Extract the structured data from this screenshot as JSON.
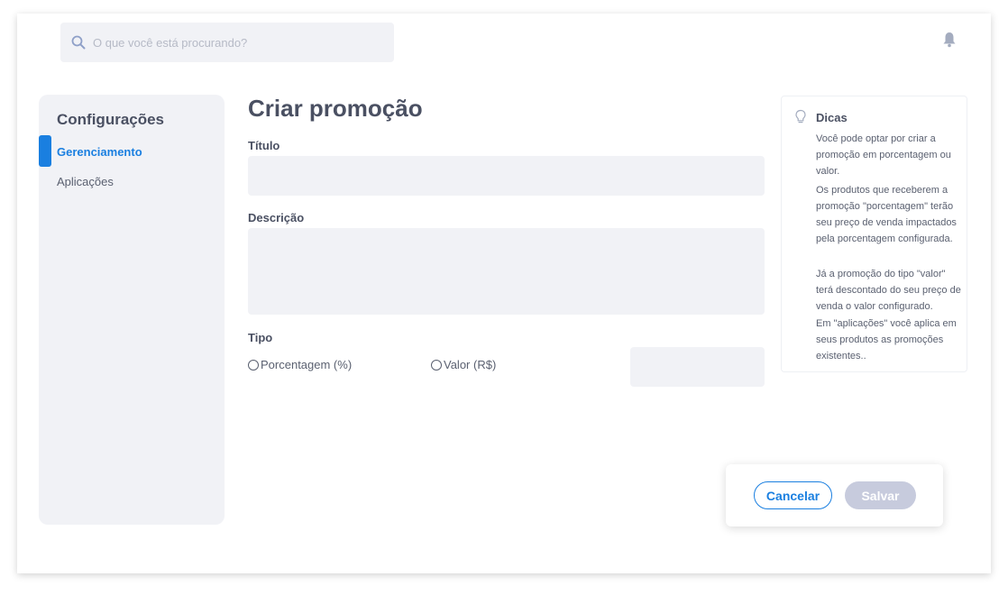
{
  "header": {
    "search_placeholder": "O que você está procurando?",
    "icons": [
      "search-icon",
      "bell-icon"
    ]
  },
  "sidebar": {
    "title": "Configurações",
    "items": [
      {
        "label": "Gerenciamento",
        "active": true
      },
      {
        "label": "Aplicações",
        "active": false
      }
    ]
  },
  "form": {
    "title": "Criar promoção",
    "titulo_label": "Título",
    "titulo_value": "",
    "descricao_label": "Descrição",
    "descricao_value": "",
    "tipo_label": "Tipo",
    "options": [
      {
        "label": "Porcentagem (%)",
        "selected": false
      },
      {
        "label": "Valor (R$)",
        "selected": false
      }
    ],
    "valor_value": ""
  },
  "tips": {
    "title": "Dicas",
    "icon": "lightbulb-icon",
    "paragraphs": [
      "Você pode optar por criar a promoção em porcentagem ou valor.",
      "Os produtos que receberem a promoção \"porcentagem\" terão seu preço de venda impactados pela porcentagem configurada.",
      "Já a promoção do tipo \"valor\" terá descontado do seu preço de venda o valor configurado.",
      "Em \"aplicações\" você aplica em seus produtos as promoções existentes.."
    ]
  },
  "actions": {
    "cancel_label": "Cancelar",
    "save_label": "Salvar"
  },
  "colors": {
    "accent": "#1a7fe0",
    "input_bg": "#f1f2f6",
    "disabled_button": "#c7cbdd"
  }
}
